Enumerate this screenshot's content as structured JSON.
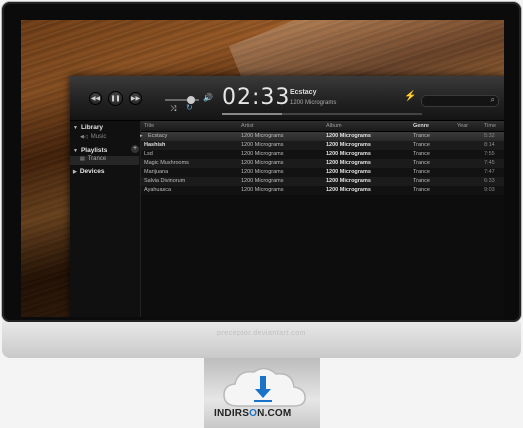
{
  "player": {
    "prev_icon": "previous-icon",
    "play_icon": "pause-icon",
    "next_icon": "next-icon",
    "time": "02:33",
    "now_playing_title": "Ecstacy",
    "now_playing_artist": "1200 Micrograms",
    "progress": 0.3,
    "shuffle_icon": "shuffle-icon",
    "repeat_icon": "repeat-icon",
    "volume_icon": "volume-icon",
    "genius_icon": "bolt-icon",
    "search_icon": "search-icon"
  },
  "sidebar": {
    "library_label": "Library",
    "music_label": "Music",
    "playlists_label": "Playlists",
    "trance_label": "Trance",
    "devices_label": "Devices"
  },
  "table": {
    "headers": [
      "Title",
      "Artist",
      "Album",
      "Genre",
      "Year",
      "Time"
    ],
    "rows": [
      {
        "title": "Ecstacy",
        "artist": "1200 Micrograms",
        "album": "1200 Micrograms",
        "genre": "Trance",
        "year": "",
        "time": "5:32"
      },
      {
        "title": "Hashish",
        "artist": "1200 Micrograms",
        "album": "1200 Micrograms",
        "genre": "Trance",
        "year": "",
        "time": "8:14"
      },
      {
        "title": "Lsd",
        "artist": "1200 Micrograms",
        "album": "1200 Micrograms",
        "genre": "Trance",
        "year": "",
        "time": "7:55"
      },
      {
        "title": "Magic Mushrooms",
        "artist": "1200 Micrograms",
        "album": "1200 Micrograms",
        "genre": "Trance",
        "year": "",
        "time": "7:45"
      },
      {
        "title": "Marijuana",
        "artist": "1200 Micrograms",
        "album": "1200 Micrograms",
        "genre": "Trance",
        "year": "",
        "time": "7:47"
      },
      {
        "title": "Salvia Divinorum",
        "artist": "1200 Micrograms",
        "album": "1200 Micrograms",
        "genre": "Trance",
        "year": "",
        "time": "6:33"
      },
      {
        "title": "Ayahuasca",
        "artist": "1200 Micrograms",
        "album": "1200 Micrograms",
        "genre": "Trance",
        "year": "",
        "time": "9:03"
      }
    ]
  },
  "chin_text": "preceptor.deviantart.com",
  "watermark": {
    "prefix": "INDIRS",
    "o": "O",
    "suffix": "N.COM"
  },
  "colors": {
    "accent": "#e0b02c",
    "logo_blue": "#1a73c8"
  }
}
